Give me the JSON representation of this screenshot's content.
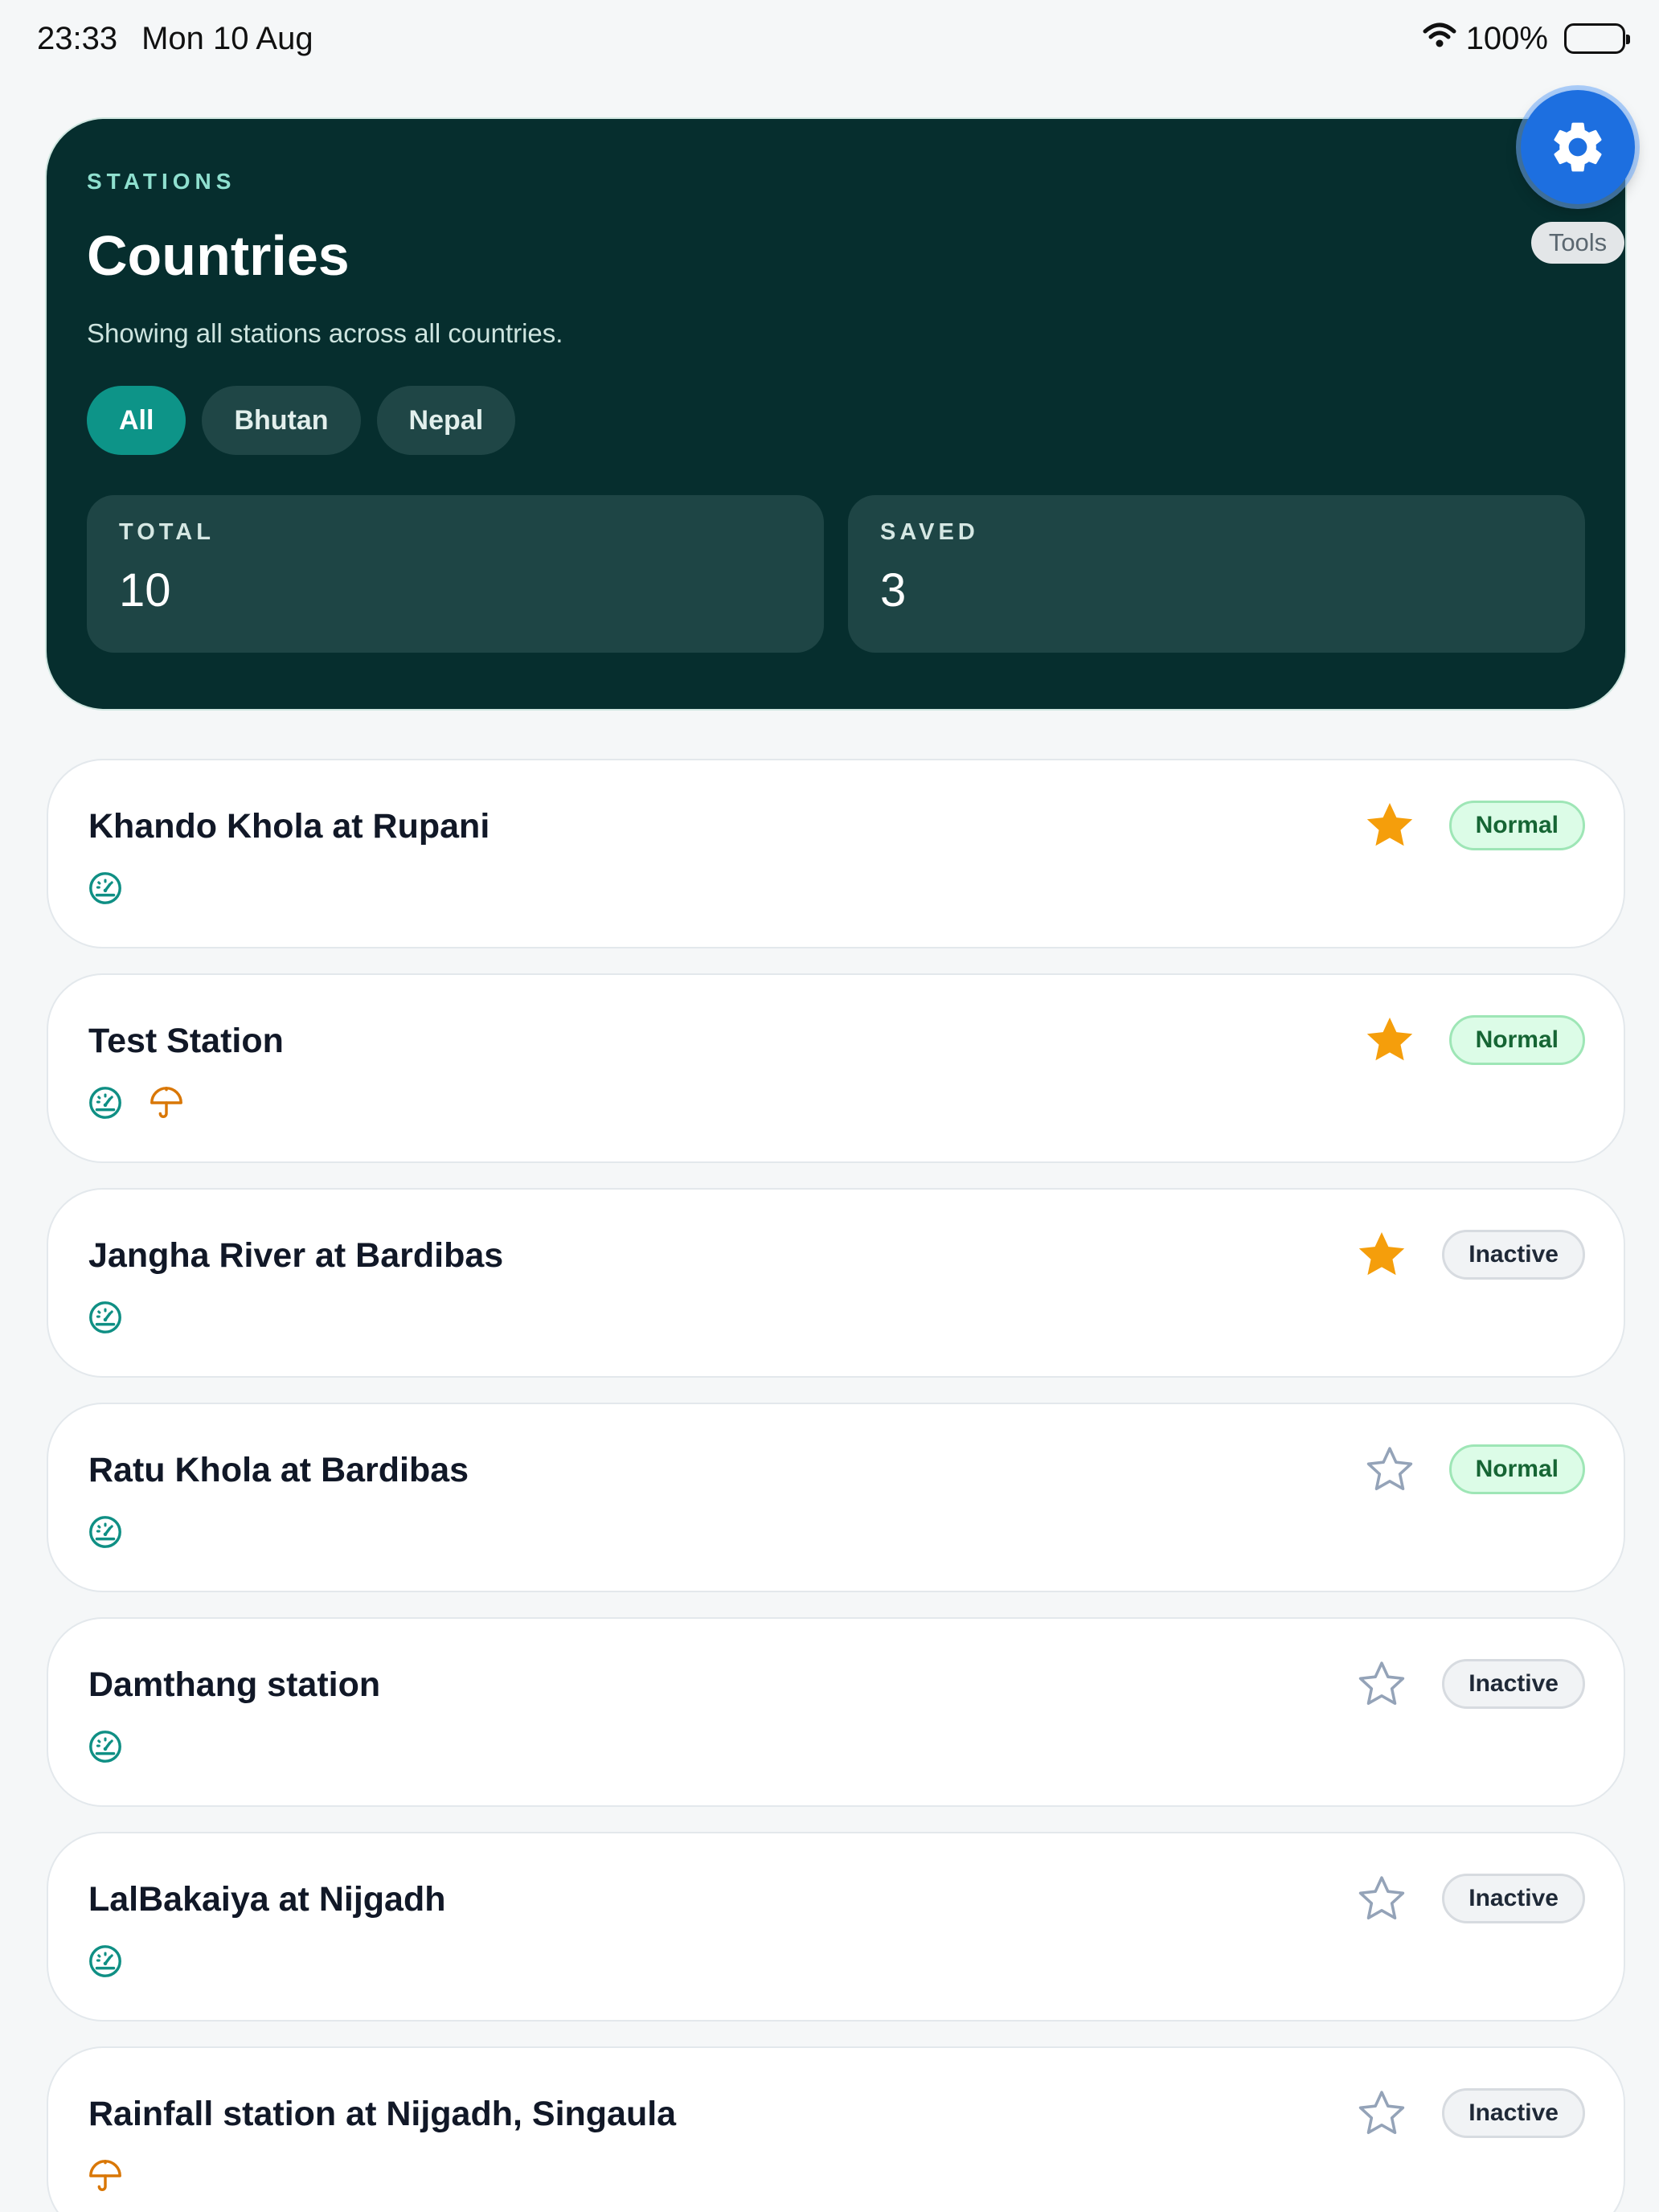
{
  "status_bar": {
    "time": "23:33",
    "date": "Mon 10 Aug",
    "battery": "100%"
  },
  "hero": {
    "eyebrow": "STATIONS",
    "title": "Countries",
    "subtitle": "Showing all stations across all countries.",
    "filters": [
      {
        "label": "All",
        "active": true
      },
      {
        "label": "Bhutan",
        "active": false
      },
      {
        "label": "Nepal",
        "active": false
      }
    ],
    "stats": {
      "total_label": "TOTAL",
      "total_value": "10",
      "saved_label": "SAVED",
      "saved_value": "3"
    }
  },
  "tools": {
    "label": "Tools"
  },
  "colors": {
    "accent": "#0d9488",
    "star_filled": "#f59e0b",
    "star_empty": "#94a3b8",
    "rain_icon": "#d97706",
    "gauge_icon": "#0f8f84"
  },
  "stations": [
    {
      "name": "Khando Khola at Rupani",
      "status": "Normal",
      "saved": true,
      "icons": [
        "gauge-icon"
      ]
    },
    {
      "name": "Test Station",
      "status": "Normal",
      "saved": true,
      "icons": [
        "gauge-icon",
        "umbrella-icon"
      ]
    },
    {
      "name": "Jangha River at Bardibas",
      "status": "Inactive",
      "saved": true,
      "icons": [
        "gauge-icon"
      ]
    },
    {
      "name": "Ratu Khola at Bardibas",
      "status": "Normal",
      "saved": false,
      "icons": [
        "gauge-icon"
      ]
    },
    {
      "name": "Damthang station",
      "status": "Inactive",
      "saved": false,
      "icons": [
        "gauge-icon"
      ]
    },
    {
      "name": "LalBakaiya at Nijgadh",
      "status": "Inactive",
      "saved": false,
      "icons": [
        "gauge-icon"
      ]
    },
    {
      "name": "Rainfall station at Nijgadh, Singaula",
      "status": "Inactive",
      "saved": false,
      "icons": [
        "umbrella-icon"
      ]
    }
  ]
}
